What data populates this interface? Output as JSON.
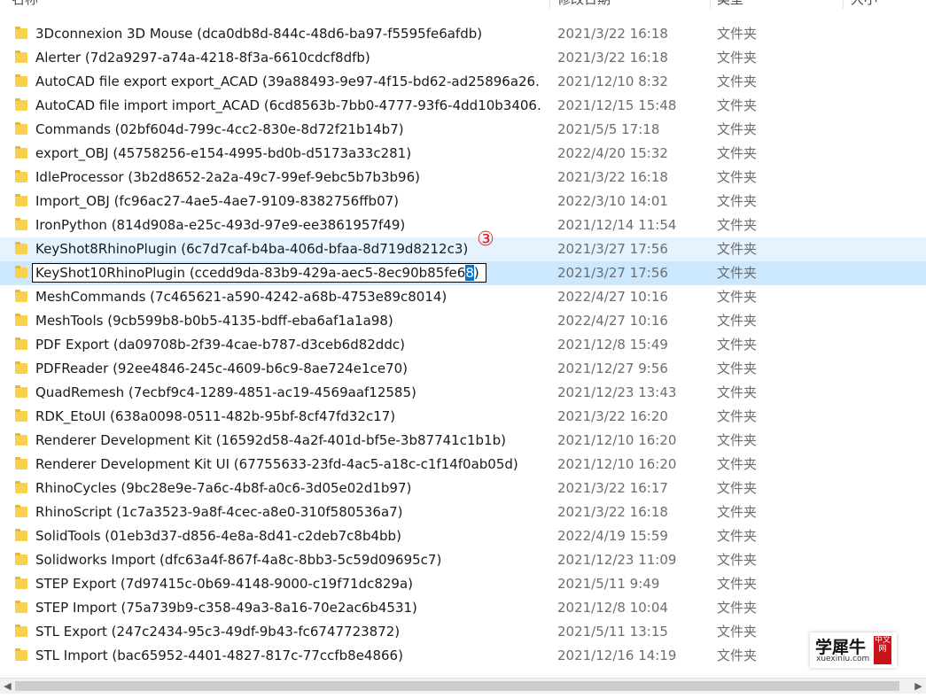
{
  "columns": {
    "name": "名称",
    "modified": "修改日期",
    "type": "类型",
    "size": "大小"
  },
  "rows": [
    {
      "name": "3Dconnexion 3D Mouse (dca0db8d-844c-48d6-ba97-f5595fe6afdb)",
      "date": "2021/3/22 16:18",
      "type": "文件夹"
    },
    {
      "name": "Alerter (7d2a9297-a74a-4218-8f3a-6610cdcf8dfb)",
      "date": "2021/3/22 16:18",
      "type": "文件夹"
    },
    {
      "name": "AutoCAD file export  export_ACAD (39a88493-9e97-4f15-bd62-ad25896a26...",
      "date": "2021/12/10 8:32",
      "type": "文件夹"
    },
    {
      "name": "AutoCAD file import import_ACAD (6cd8563b-7bb0-4777-93f6-4dd10b3406...",
      "date": "2021/12/15 15:48",
      "type": "文件夹"
    },
    {
      "name": "Commands (02bf604d-799c-4cc2-830e-8d72f21b14b7)",
      "date": "2021/5/5 17:18",
      "type": "文件夹"
    },
    {
      "name": "export_OBJ (45758256-e154-4995-bd0b-d5173a33c281)",
      "date": "2022/4/20 15:32",
      "type": "文件夹"
    },
    {
      "name": "IdleProcessor (3b2d8652-2a2a-49c7-99ef-9ebc5b7b3b96)",
      "date": "2021/3/22 16:18",
      "type": "文件夹"
    },
    {
      "name": "Import_OBJ (fc96ac27-4ae5-4ae7-9109-8382756ffb07)",
      "date": "2022/3/10 14:01",
      "type": "文件夹"
    },
    {
      "name": "IronPython (814d908a-e25c-493d-97e9-ee3861957f49)",
      "date": "2021/12/14 11:54",
      "type": "文件夹"
    },
    {
      "name": "KeyShot8RhinoPlugin (6c7d7caf-b4ba-406d-bfaa-8d719d8212c3)",
      "date": "2021/3/27 17:56",
      "type": "文件夹",
      "state": "hover"
    },
    {
      "name": "",
      "date": "2021/3/27 17:56",
      "type": "文件夹",
      "state": "selected"
    },
    {
      "name": "MeshCommands (7c465621-a590-4242-a68b-4753e89c8014)",
      "date": "2022/4/27 10:16",
      "type": "文件夹"
    },
    {
      "name": "MeshTools (9cb599b8-b0b5-4135-bdff-eba6af1a1a98)",
      "date": "2022/4/27 10:16",
      "type": "文件夹"
    },
    {
      "name": "PDF Export (da09708b-2f39-4cae-b787-d3ceb6d82ddc)",
      "date": "2021/12/8 15:49",
      "type": "文件夹"
    },
    {
      "name": "PDFReader (92ee4846-245c-4609-b6c9-8ae724e1ce70)",
      "date": "2021/12/27 9:56",
      "type": "文件夹"
    },
    {
      "name": "QuadRemesh (7ecbf9c4-1289-4851-ac19-4569aaf12585)",
      "date": "2021/12/23 13:43",
      "type": "文件夹"
    },
    {
      "name": "RDK_EtoUI (638a0098-0511-482b-95bf-8cf47fd32c17)",
      "date": "2021/3/22 16:20",
      "type": "文件夹"
    },
    {
      "name": "Renderer Development Kit (16592d58-4a2f-401d-bf5e-3b87741c1b1b)",
      "date": "2021/12/10 16:20",
      "type": "文件夹"
    },
    {
      "name": "Renderer Development Kit UI (67755633-23fd-4ac5-a18c-c1f14f0ab05d)",
      "date": "2021/12/10 16:20",
      "type": "文件夹"
    },
    {
      "name": "RhinoCycles (9bc28e9e-7a6c-4b8f-a0c6-3d05e02d1b97)",
      "date": "2021/3/22 16:17",
      "type": "文件夹"
    },
    {
      "name": "RhinoScript (1c7a3523-9a8f-4cec-a8e0-310f580536a7)",
      "date": "2021/3/22 16:18",
      "type": "文件夹"
    },
    {
      "name": "SolidTools (01eb3d37-d856-4e8a-8d41-c2deb7c8b4bb)",
      "date": "2022/4/19 15:59",
      "type": "文件夹"
    },
    {
      "name": "Solidworks Import (dfc63a4f-867f-4a8c-8bb3-5c59d09695c7)",
      "date": "2021/12/23 11:09",
      "type": "文件夹"
    },
    {
      "name": "STEP Export (7d97415c-0b69-4148-9000-c19f71dc829a)",
      "date": "2021/5/11 9:49",
      "type": "文件夹"
    },
    {
      "name": "STEP Import (75a739b9-c358-49a3-8a16-70e2ac6b4531)",
      "date": "2021/12/8 10:04",
      "type": "文件夹"
    },
    {
      "name": "STL Export (247c2434-95c3-49df-9b43-fc6747723872)",
      "date": "2021/5/11 13:15",
      "type": "文件夹"
    },
    {
      "name": "STL Import (bac65952-4401-4827-817c-77ccfb8e4866)",
      "date": "2021/12/16 14:19",
      "type": "文件夹"
    }
  ],
  "rename": {
    "before": "KeyShot10RhinoPlugin (ccedd9da-83b9-429a-aec5-8ec90b85fe6",
    "selected": "8",
    "after": ")"
  },
  "annotation": "③",
  "watermark": {
    "title": "学犀牛",
    "site": "xuexiniu.com",
    "badge": "中文网"
  },
  "scrollbar": {
    "left_icon": "chevron-left-icon",
    "right_icon": "chevron-right-icon"
  }
}
